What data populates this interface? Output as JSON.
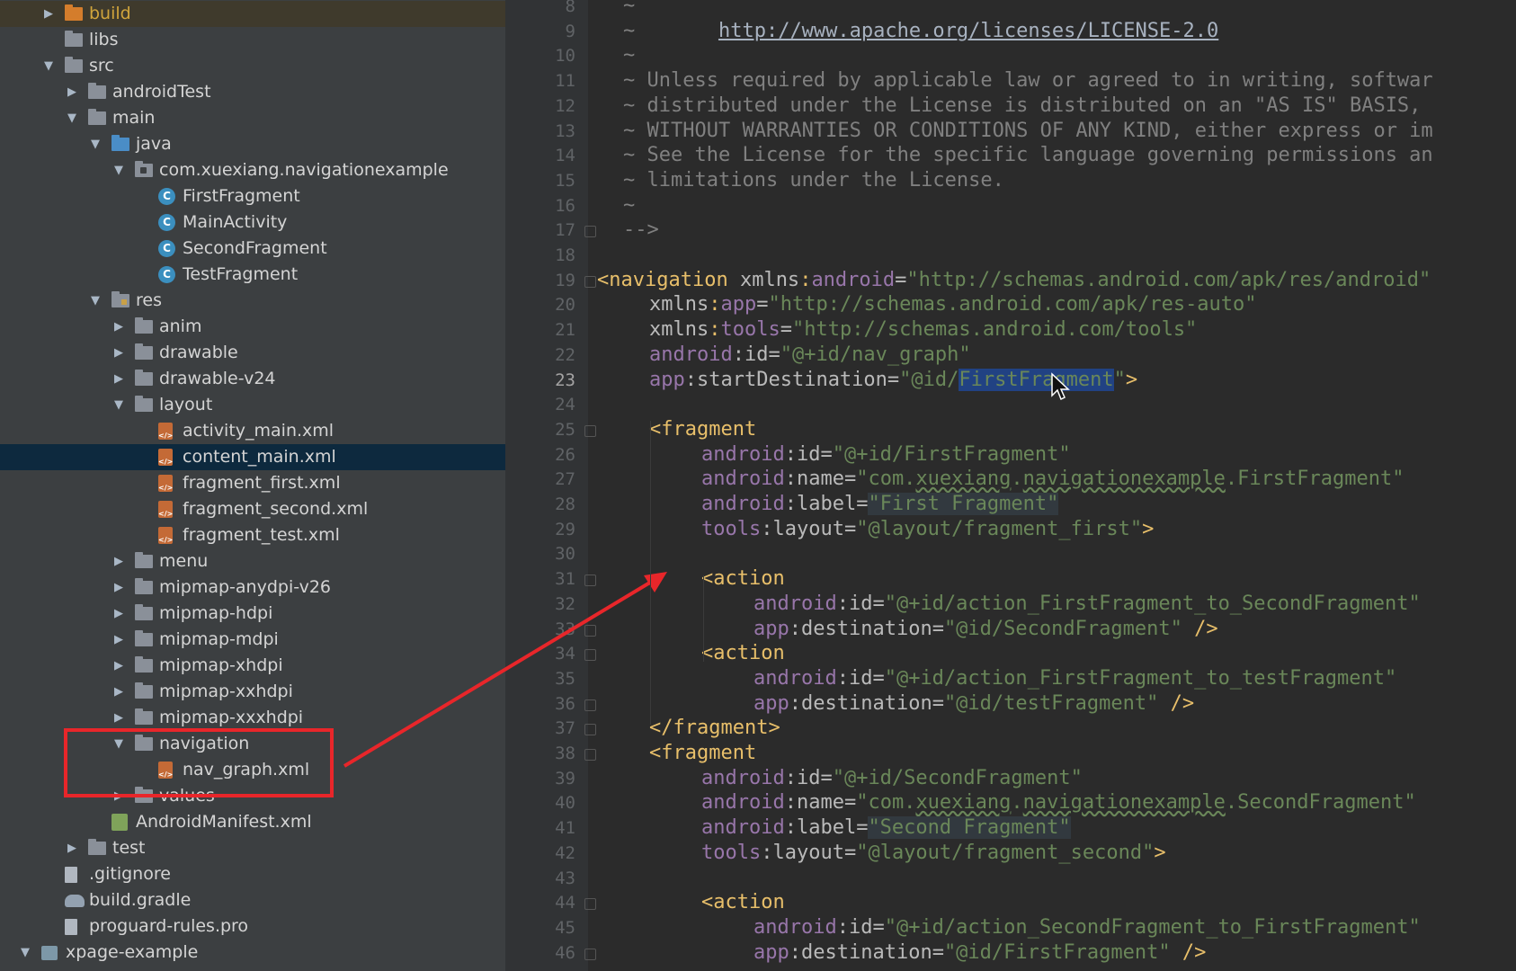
{
  "tree": {
    "items": [
      {
        "label": "build",
        "icon": "folder-orange",
        "expanded": false,
        "build": true
      },
      {
        "label": "libs",
        "icon": "folder",
        "expanded": null
      },
      {
        "label": "src",
        "icon": "folder",
        "expanded": true
      },
      {
        "label": "androidTest",
        "icon": "folder",
        "expanded": false
      },
      {
        "label": "main",
        "icon": "folder",
        "expanded": true
      },
      {
        "label": "java",
        "icon": "folder-blue",
        "expanded": true
      },
      {
        "label": "com.xuexiang.navigationexample",
        "icon": "package",
        "expanded": true
      },
      {
        "label": "FirstFragment",
        "icon": "class"
      },
      {
        "label": "MainActivity",
        "icon": "class"
      },
      {
        "label": "SecondFragment",
        "icon": "class"
      },
      {
        "label": "TestFragment",
        "icon": "class"
      },
      {
        "label": "res",
        "icon": "folder-res",
        "expanded": true
      },
      {
        "label": "anim",
        "icon": "folder",
        "expanded": false
      },
      {
        "label": "drawable",
        "icon": "folder",
        "expanded": false
      },
      {
        "label": "drawable-v24",
        "icon": "folder",
        "expanded": false
      },
      {
        "label": "layout",
        "icon": "folder",
        "expanded": true
      },
      {
        "label": "activity_main.xml",
        "icon": "xml"
      },
      {
        "label": "content_main.xml",
        "icon": "xml",
        "selected": true
      },
      {
        "label": "fragment_first.xml",
        "icon": "xml"
      },
      {
        "label": "fragment_second.xml",
        "icon": "xml"
      },
      {
        "label": "fragment_test.xml",
        "icon": "xml"
      },
      {
        "label": "menu",
        "icon": "folder",
        "expanded": false
      },
      {
        "label": "mipmap-anydpi-v26",
        "icon": "folder",
        "expanded": false
      },
      {
        "label": "mipmap-hdpi",
        "icon": "folder",
        "expanded": false
      },
      {
        "label": "mipmap-mdpi",
        "icon": "folder",
        "expanded": false
      },
      {
        "label": "mipmap-xhdpi",
        "icon": "folder",
        "expanded": false
      },
      {
        "label": "mipmap-xxhdpi",
        "icon": "folder",
        "expanded": false
      },
      {
        "label": "mipmap-xxxhdpi",
        "icon": "folder",
        "expanded": false
      },
      {
        "label": "navigation",
        "icon": "folder",
        "expanded": true
      },
      {
        "label": "nav_graph.xml",
        "icon": "xml"
      },
      {
        "label": "values",
        "icon": "folder",
        "expanded": false
      },
      {
        "label": "AndroidManifest.xml",
        "icon": "manifest"
      },
      {
        "label": "test",
        "icon": "folder",
        "expanded": false
      },
      {
        "label": ".gitignore",
        "icon": "file"
      },
      {
        "label": "build.gradle",
        "icon": "gradle"
      },
      {
        "label": "proguard-rules.pro",
        "icon": "file"
      },
      {
        "label": "xpage-example",
        "icon": "module",
        "expanded": true
      }
    ]
  },
  "editor": {
    "current_line": 23,
    "lines": [
      {
        "n": 8,
        "indent": 1,
        "segs": [
          [
            "com",
            "~"
          ]
        ]
      },
      {
        "n": 9,
        "indent": 1,
        "segs": [
          [
            "com",
            "~       "
          ],
          [
            "link",
            "http://www.apache.org/licenses/LICENSE-2.0"
          ]
        ]
      },
      {
        "n": 10,
        "indent": 1,
        "segs": [
          [
            "com",
            "~"
          ]
        ]
      },
      {
        "n": 11,
        "indent": 1,
        "segs": [
          [
            "com",
            "~ Unless required by applicable law or agreed to in writing, softwar"
          ]
        ]
      },
      {
        "n": 12,
        "indent": 1,
        "segs": [
          [
            "com",
            "~ distributed under the License is distributed on an \"AS IS\" BASIS,"
          ]
        ]
      },
      {
        "n": 13,
        "indent": 1,
        "segs": [
          [
            "com",
            "~ WITHOUT WARRANTIES OR CONDITIONS OF ANY KIND, either express or im"
          ]
        ]
      },
      {
        "n": 14,
        "indent": 1,
        "segs": [
          [
            "com",
            "~ See the License for the specific language governing permissions an"
          ]
        ]
      },
      {
        "n": 15,
        "indent": 1,
        "segs": [
          [
            "com",
            "~ limitations under the License."
          ]
        ]
      },
      {
        "n": 16,
        "indent": 1,
        "segs": [
          [
            "com",
            "~"
          ]
        ]
      },
      {
        "n": 17,
        "indent": 1,
        "segs": [
          [
            "com",
            "-->"
          ]
        ]
      },
      {
        "n": 18,
        "indent": 0,
        "segs": []
      },
      {
        "n": 19,
        "indent": 0,
        "segs": [
          [
            "tag",
            "<navigation "
          ],
          [
            "at",
            "xmlns"
          ],
          [
            "tag",
            ":"
          ],
          [
            "ns",
            "android"
          ],
          [
            "at",
            "="
          ],
          [
            "str",
            "\"http://schemas.android.com/apk/res/android\""
          ]
        ]
      },
      {
        "n": 20,
        "indent": 2,
        "segs": [
          [
            "at",
            "xmlns"
          ],
          [
            "tag",
            ":"
          ],
          [
            "ns",
            "app"
          ],
          [
            "at",
            "="
          ],
          [
            "str",
            "\"http://schemas.android.com/apk/res-auto\""
          ]
        ]
      },
      {
        "n": 21,
        "indent": 2,
        "segs": [
          [
            "at",
            "xmlns"
          ],
          [
            "tag",
            ":"
          ],
          [
            "ns",
            "tools"
          ],
          [
            "at",
            "="
          ],
          [
            "str",
            "\"http://schemas.android.com/tools\""
          ]
        ]
      },
      {
        "n": 22,
        "indent": 2,
        "segs": [
          [
            "ns",
            "android"
          ],
          [
            "at",
            ":id="
          ],
          [
            "str",
            "\"@+id/nav_graph\""
          ]
        ]
      },
      {
        "n": 23,
        "indent": 2,
        "segs": [
          [
            "ns",
            "app"
          ],
          [
            "at",
            ":startDestination="
          ],
          [
            "str",
            "\"@id/"
          ],
          [
            "sel",
            "FirstFragment"
          ],
          [
            "str",
            "\""
          ],
          [
            "tag",
            ">"
          ]
        ]
      },
      {
        "n": 24,
        "indent": 0,
        "segs": []
      },
      {
        "n": 25,
        "indent": 2,
        "segs": [
          [
            "tag",
            "<fragment"
          ]
        ]
      },
      {
        "n": 26,
        "indent": 4,
        "segs": [
          [
            "ns",
            "android"
          ],
          [
            "at",
            ":id="
          ],
          [
            "str",
            "\"@+id/FirstFragment\""
          ]
        ]
      },
      {
        "n": 27,
        "indent": 4,
        "segs": [
          [
            "ns",
            "android"
          ],
          [
            "at",
            ":name="
          ],
          [
            "str",
            "\"com."
          ],
          [
            "und",
            "xuexiang"
          ],
          [
            "str",
            "."
          ],
          [
            "und",
            "navigationexample"
          ],
          [
            "str",
            ".FirstFragment\""
          ]
        ]
      },
      {
        "n": 28,
        "indent": 4,
        "segs": [
          [
            "ns",
            "android"
          ],
          [
            "at",
            ":label="
          ],
          [
            "hl",
            "\"First Fragment\""
          ]
        ]
      },
      {
        "n": 29,
        "indent": 4,
        "segs": [
          [
            "ns",
            "tools"
          ],
          [
            "at",
            ":layout="
          ],
          [
            "str",
            "\"@layout/fragment_first\""
          ],
          [
            "tag",
            ">"
          ]
        ]
      },
      {
        "n": 30,
        "indent": 0,
        "segs": []
      },
      {
        "n": 31,
        "indent": 4,
        "segs": [
          [
            "tag",
            "<action"
          ]
        ]
      },
      {
        "n": 32,
        "indent": 6,
        "segs": [
          [
            "ns",
            "android"
          ],
          [
            "at",
            ":id="
          ],
          [
            "str",
            "\"@+id/action_FirstFragment_to_SecondFragment\""
          ]
        ]
      },
      {
        "n": 33,
        "indent": 6,
        "segs": [
          [
            "ns",
            "app"
          ],
          [
            "at",
            ":destination="
          ],
          [
            "str",
            "\"@id/SecondFragment\""
          ],
          [
            "tag",
            " />"
          ]
        ]
      },
      {
        "n": 34,
        "indent": 4,
        "segs": [
          [
            "tag",
            "<action"
          ]
        ]
      },
      {
        "n": 35,
        "indent": 6,
        "segs": [
          [
            "ns",
            "android"
          ],
          [
            "at",
            ":id="
          ],
          [
            "str",
            "\"@+id/action_FirstFragment_to_testFragment\""
          ]
        ]
      },
      {
        "n": 36,
        "indent": 6,
        "segs": [
          [
            "ns",
            "app"
          ],
          [
            "at",
            ":destination="
          ],
          [
            "str",
            "\"@id/testFragment\""
          ],
          [
            "tag",
            " />"
          ]
        ]
      },
      {
        "n": 37,
        "indent": 2,
        "segs": [
          [
            "tag",
            "</fragment>"
          ]
        ]
      },
      {
        "n": 38,
        "indent": 2,
        "segs": [
          [
            "tag",
            "<fragment"
          ]
        ]
      },
      {
        "n": 39,
        "indent": 4,
        "segs": [
          [
            "ns",
            "android"
          ],
          [
            "at",
            ":id="
          ],
          [
            "str",
            "\"@+id/SecondFragment\""
          ]
        ]
      },
      {
        "n": 40,
        "indent": 4,
        "segs": [
          [
            "ns",
            "android"
          ],
          [
            "at",
            ":name="
          ],
          [
            "str",
            "\"com."
          ],
          [
            "und",
            "xuexiang"
          ],
          [
            "str",
            "."
          ],
          [
            "und",
            "navigationexample"
          ],
          [
            "str",
            ".SecondFragment\""
          ]
        ]
      },
      {
        "n": 41,
        "indent": 4,
        "segs": [
          [
            "ns",
            "android"
          ],
          [
            "at",
            ":label="
          ],
          [
            "hl",
            "\"Second Fragment\""
          ]
        ]
      },
      {
        "n": 42,
        "indent": 4,
        "segs": [
          [
            "ns",
            "tools"
          ],
          [
            "at",
            ":layout="
          ],
          [
            "str",
            "\"@layout/fragment_second\""
          ],
          [
            "tag",
            ">"
          ]
        ]
      },
      {
        "n": 43,
        "indent": 0,
        "segs": []
      },
      {
        "n": 44,
        "indent": 4,
        "segs": [
          [
            "tag",
            "<action"
          ]
        ]
      },
      {
        "n": 45,
        "indent": 6,
        "segs": [
          [
            "ns",
            "android"
          ],
          [
            "at",
            ":id="
          ],
          [
            "str",
            "\"@+id/action_SecondFragment_to_FirstFragment\""
          ]
        ]
      },
      {
        "n": 46,
        "indent": 6,
        "segs": [
          [
            "ns",
            "app"
          ],
          [
            "at",
            ":destination="
          ],
          [
            "str",
            "\"@id/FirstFragment\""
          ],
          [
            "tag",
            " />"
          ]
        ]
      }
    ]
  },
  "annotation": {
    "color": "#e8262a"
  }
}
